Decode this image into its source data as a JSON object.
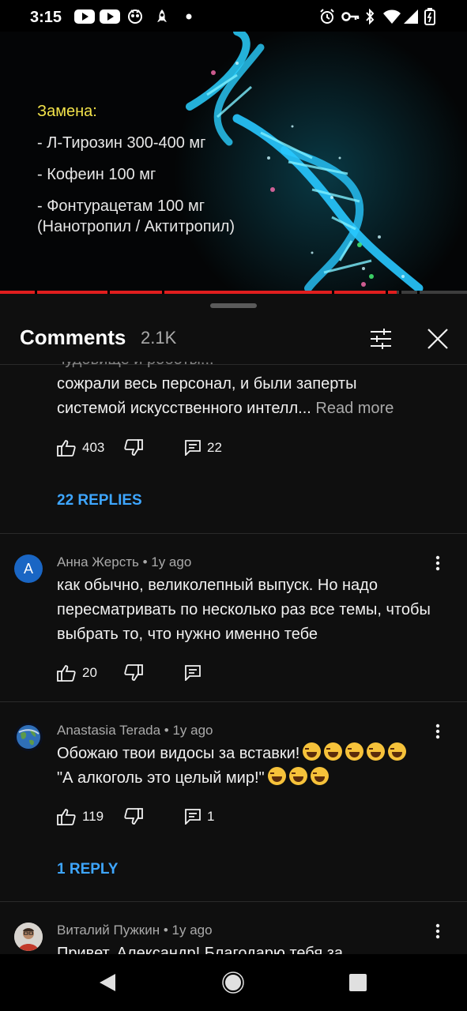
{
  "status_bar": {
    "time": "3:15",
    "left_icons": [
      "youtube-icon",
      "youtube-icon",
      "brain-app-icon",
      "rocket-app-icon",
      "dot-icon"
    ],
    "right_icons": [
      "alarm-icon",
      "vpn-key-icon",
      "bluetooth-icon",
      "wifi-icon",
      "signal-icon",
      "battery-icon"
    ]
  },
  "video": {
    "title": "Замена:",
    "lines": [
      "- Л-Тирозин 300-400 мг",
      "- Кофеин 100 мг",
      "- Фонтурацетам 100 мг",
      "(Нанотропил / Актитропил)"
    ],
    "progress_percent": 85,
    "colors": {
      "title": "#f2e24a",
      "progress": "#e01e1e",
      "dna": "#19d3ff"
    }
  },
  "comments_panel": {
    "title": "Comments",
    "count": "2.1K",
    "filter_icon": "sliders-icon",
    "close_icon": "close-icon"
  },
  "comments": [
    {
      "partial_text_line1": "сожрали весь персонал, и были заперты",
      "partial_text_line2": "системой искусственного интелл...",
      "read_more": "Read more",
      "likes": "403",
      "reply_count": "22",
      "replies_link": "22 REPLIES"
    },
    {
      "author": "Анна Жерсть",
      "time": "1y ago",
      "avatar_letter": "A",
      "avatar_color": "#1a66c4",
      "text": "как обычно, великолепный выпуск. Но надо пересматривать по несколько раз все темы, чтобы выбрать то, что нужно именно тебе",
      "likes": "20",
      "reply_count": ""
    },
    {
      "author": "Anastasia Terada",
      "time": "1y ago",
      "text_line1": "Обожаю твои видосы за вставки!",
      "text_line2": "\"А алкоголь это целый мир!\"",
      "emoji_line1": [
        "laughing-tears-emoji",
        "laughing-tears-emoji",
        "laughing-tears-emoji",
        "laughing-tears-emoji",
        "laughing-tears-emoji"
      ],
      "emoji_line2": [
        "laughing-tears-emoji",
        "laughing-tears-emoji",
        "laughing-tears-emoji"
      ],
      "likes": "119",
      "reply_count": "1",
      "replies_link": "1 REPLY"
    },
    {
      "author": "Виталий Пужкин",
      "time": "1y ago",
      "text_partial": "Привет, Александр! Благодарю тебя за"
    }
  ],
  "colors": {
    "link_blue": "#3ea6ff",
    "secondary_text": "#aaaaaa",
    "background": "#0f0f0f"
  },
  "nav_bar": {
    "back_icon": "back-triangle-icon",
    "home_icon": "home-circle-icon",
    "recents_icon": "recents-square-icon"
  }
}
